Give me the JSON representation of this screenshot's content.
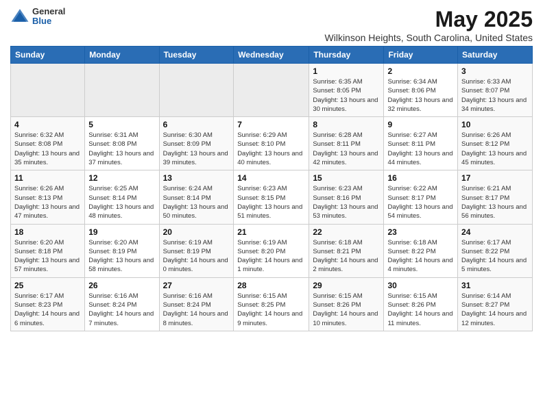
{
  "header": {
    "logo": {
      "general": "General",
      "blue": "Blue"
    },
    "month": "May 2025",
    "location": "Wilkinson Heights, South Carolina, United States"
  },
  "weekdays": [
    "Sunday",
    "Monday",
    "Tuesday",
    "Wednesday",
    "Thursday",
    "Friday",
    "Saturday"
  ],
  "weeks": [
    [
      {
        "day": "",
        "sunrise": "",
        "sunset": "",
        "daylight": "",
        "empty": true
      },
      {
        "day": "",
        "sunrise": "",
        "sunset": "",
        "daylight": "",
        "empty": true
      },
      {
        "day": "",
        "sunrise": "",
        "sunset": "",
        "daylight": "",
        "empty": true
      },
      {
        "day": "",
        "sunrise": "",
        "sunset": "",
        "daylight": "",
        "empty": true
      },
      {
        "day": "1",
        "sunrise": "Sunrise: 6:35 AM",
        "sunset": "Sunset: 8:05 PM",
        "daylight": "Daylight: 13 hours and 30 minutes."
      },
      {
        "day": "2",
        "sunrise": "Sunrise: 6:34 AM",
        "sunset": "Sunset: 8:06 PM",
        "daylight": "Daylight: 13 hours and 32 minutes."
      },
      {
        "day": "3",
        "sunrise": "Sunrise: 6:33 AM",
        "sunset": "Sunset: 8:07 PM",
        "daylight": "Daylight: 13 hours and 34 minutes."
      }
    ],
    [
      {
        "day": "4",
        "sunrise": "Sunrise: 6:32 AM",
        "sunset": "Sunset: 8:08 PM",
        "daylight": "Daylight: 13 hours and 35 minutes."
      },
      {
        "day": "5",
        "sunrise": "Sunrise: 6:31 AM",
        "sunset": "Sunset: 8:08 PM",
        "daylight": "Daylight: 13 hours and 37 minutes."
      },
      {
        "day": "6",
        "sunrise": "Sunrise: 6:30 AM",
        "sunset": "Sunset: 8:09 PM",
        "daylight": "Daylight: 13 hours and 39 minutes."
      },
      {
        "day": "7",
        "sunrise": "Sunrise: 6:29 AM",
        "sunset": "Sunset: 8:10 PM",
        "daylight": "Daylight: 13 hours and 40 minutes."
      },
      {
        "day": "8",
        "sunrise": "Sunrise: 6:28 AM",
        "sunset": "Sunset: 8:11 PM",
        "daylight": "Daylight: 13 hours and 42 minutes."
      },
      {
        "day": "9",
        "sunrise": "Sunrise: 6:27 AM",
        "sunset": "Sunset: 8:11 PM",
        "daylight": "Daylight: 13 hours and 44 minutes."
      },
      {
        "day": "10",
        "sunrise": "Sunrise: 6:26 AM",
        "sunset": "Sunset: 8:12 PM",
        "daylight": "Daylight: 13 hours and 45 minutes."
      }
    ],
    [
      {
        "day": "11",
        "sunrise": "Sunrise: 6:26 AM",
        "sunset": "Sunset: 8:13 PM",
        "daylight": "Daylight: 13 hours and 47 minutes."
      },
      {
        "day": "12",
        "sunrise": "Sunrise: 6:25 AM",
        "sunset": "Sunset: 8:14 PM",
        "daylight": "Daylight: 13 hours and 48 minutes."
      },
      {
        "day": "13",
        "sunrise": "Sunrise: 6:24 AM",
        "sunset": "Sunset: 8:14 PM",
        "daylight": "Daylight: 13 hours and 50 minutes."
      },
      {
        "day": "14",
        "sunrise": "Sunrise: 6:23 AM",
        "sunset": "Sunset: 8:15 PM",
        "daylight": "Daylight: 13 hours and 51 minutes."
      },
      {
        "day": "15",
        "sunrise": "Sunrise: 6:23 AM",
        "sunset": "Sunset: 8:16 PM",
        "daylight": "Daylight: 13 hours and 53 minutes."
      },
      {
        "day": "16",
        "sunrise": "Sunrise: 6:22 AM",
        "sunset": "Sunset: 8:17 PM",
        "daylight": "Daylight: 13 hours and 54 minutes."
      },
      {
        "day": "17",
        "sunrise": "Sunrise: 6:21 AM",
        "sunset": "Sunset: 8:17 PM",
        "daylight": "Daylight: 13 hours and 56 minutes."
      }
    ],
    [
      {
        "day": "18",
        "sunrise": "Sunrise: 6:20 AM",
        "sunset": "Sunset: 8:18 PM",
        "daylight": "Daylight: 13 hours and 57 minutes."
      },
      {
        "day": "19",
        "sunrise": "Sunrise: 6:20 AM",
        "sunset": "Sunset: 8:19 PM",
        "daylight": "Daylight: 13 hours and 58 minutes."
      },
      {
        "day": "20",
        "sunrise": "Sunrise: 6:19 AM",
        "sunset": "Sunset: 8:19 PM",
        "daylight": "Daylight: 14 hours and 0 minutes."
      },
      {
        "day": "21",
        "sunrise": "Sunrise: 6:19 AM",
        "sunset": "Sunset: 8:20 PM",
        "daylight": "Daylight: 14 hours and 1 minute."
      },
      {
        "day": "22",
        "sunrise": "Sunrise: 6:18 AM",
        "sunset": "Sunset: 8:21 PM",
        "daylight": "Daylight: 14 hours and 2 minutes."
      },
      {
        "day": "23",
        "sunrise": "Sunrise: 6:18 AM",
        "sunset": "Sunset: 8:22 PM",
        "daylight": "Daylight: 14 hours and 4 minutes."
      },
      {
        "day": "24",
        "sunrise": "Sunrise: 6:17 AM",
        "sunset": "Sunset: 8:22 PM",
        "daylight": "Daylight: 14 hours and 5 minutes."
      }
    ],
    [
      {
        "day": "25",
        "sunrise": "Sunrise: 6:17 AM",
        "sunset": "Sunset: 8:23 PM",
        "daylight": "Daylight: 14 hours and 6 minutes."
      },
      {
        "day": "26",
        "sunrise": "Sunrise: 6:16 AM",
        "sunset": "Sunset: 8:24 PM",
        "daylight": "Daylight: 14 hours and 7 minutes."
      },
      {
        "day": "27",
        "sunrise": "Sunrise: 6:16 AM",
        "sunset": "Sunset: 8:24 PM",
        "daylight": "Daylight: 14 hours and 8 minutes."
      },
      {
        "day": "28",
        "sunrise": "Sunrise: 6:15 AM",
        "sunset": "Sunset: 8:25 PM",
        "daylight": "Daylight: 14 hours and 9 minutes."
      },
      {
        "day": "29",
        "sunrise": "Sunrise: 6:15 AM",
        "sunset": "Sunset: 8:26 PM",
        "daylight": "Daylight: 14 hours and 10 minutes."
      },
      {
        "day": "30",
        "sunrise": "Sunrise: 6:15 AM",
        "sunset": "Sunset: 8:26 PM",
        "daylight": "Daylight: 14 hours and 11 minutes."
      },
      {
        "day": "31",
        "sunrise": "Sunrise: 6:14 AM",
        "sunset": "Sunset: 8:27 PM",
        "daylight": "Daylight: 14 hours and 12 minutes."
      }
    ]
  ]
}
